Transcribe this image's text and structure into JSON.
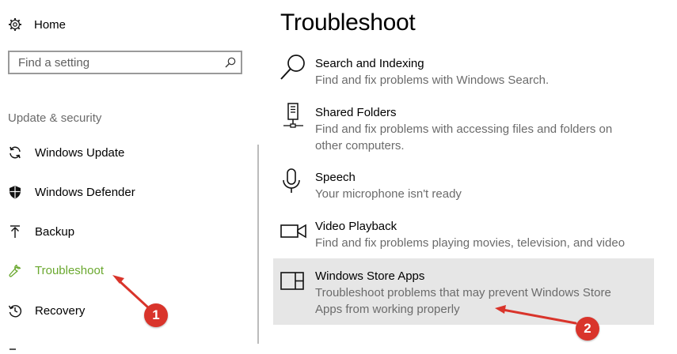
{
  "sidebar": {
    "home_label": "Home",
    "search_placeholder": "Find a setting",
    "section_label": "Update & security",
    "items": [
      {
        "label": "Windows Update",
        "icon": "sync-icon"
      },
      {
        "label": "Windows Defender",
        "icon": "shield-icon"
      },
      {
        "label": "Backup",
        "icon": "upload-arrow-icon"
      },
      {
        "label": "Troubleshoot",
        "icon": "wrench-icon",
        "active": true
      },
      {
        "label": "Recovery",
        "icon": "history-icon"
      }
    ],
    "accent_color": "#6aa82f"
  },
  "main": {
    "title": "Troubleshoot",
    "items": [
      {
        "name": "Search and Indexing",
        "desc": "Find and fix problems with Windows Search.",
        "icon": "magnifier-icon"
      },
      {
        "name": "Shared Folders",
        "desc": "Find and fix problems with accessing files and folders on other computers.",
        "icon": "network-computer-icon"
      },
      {
        "name": "Speech",
        "desc": "Your microphone isn't ready",
        "icon": "microphone-icon"
      },
      {
        "name": "Video Playback",
        "desc": "Find and fix problems playing movies, television, and video",
        "icon": "video-camera-icon"
      },
      {
        "name": "Windows Store Apps",
        "desc": "Troubleshoot problems that may prevent Windows Store Apps from working properly",
        "icon": "store-apps-icon",
        "selected": true
      }
    ]
  },
  "annotations": {
    "badge_1": "1",
    "badge_2": "2",
    "color": "#d9342b"
  }
}
